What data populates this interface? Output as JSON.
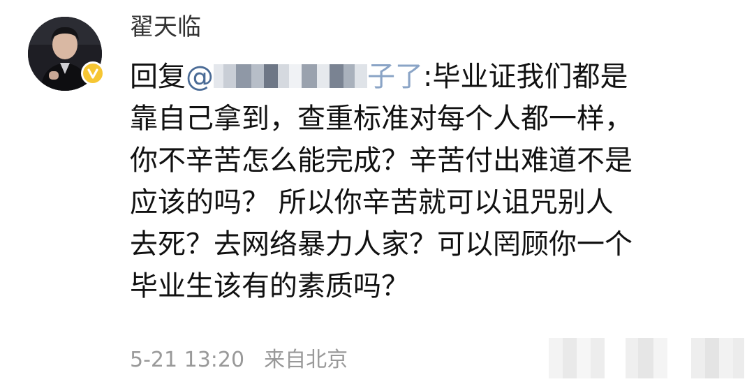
{
  "comment": {
    "username": "翟天临",
    "reply_prefix": "回复",
    "mention_at": "@",
    "mention_tail": "子了",
    "text_lines": [
      ":毕业证我们都是",
      "靠自己拿到，查重标准对每个人都一样，",
      "你不辛苦怎么能完成？辛苦付出难道不是",
      "应该的吗？ 所以你辛苦就可以诅咒别人",
      "去死？去网络暴力人家？可以罔顾你一个",
      "毕业生该有的素质吗？"
    ],
    "timestamp": "5-21 13:20",
    "source": "来自北京"
  },
  "icons": {
    "avatar": "user-avatar-photo",
    "badge": "verified-badge-icon"
  },
  "colors": {
    "mention": "#4a6b96",
    "badge": "#f6c633",
    "meta_text": "#999999",
    "body_text": "#111111"
  }
}
